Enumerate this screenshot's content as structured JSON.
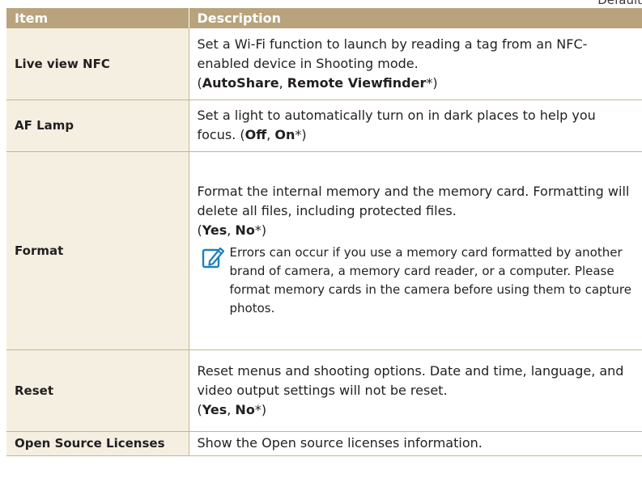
{
  "corner_label": "Default",
  "table": {
    "headers": [
      "Item",
      "Description"
    ],
    "rows": [
      {
        "item": "Live view NFC",
        "description": "Set a Wi-Fi function to launch by reading a tag from an NFC-enabled device in Shooting mode.",
        "options": [
          "AutoShare",
          "Remote Viewfinder"
        ],
        "default_marker": "*"
      },
      {
        "item": "AF Lamp",
        "description": "Set a light to automatically turn on in dark places to help you focus.",
        "options": [
          "Off",
          "On"
        ],
        "default_marker": "*"
      },
      {
        "item": "Format",
        "description": "Format the internal memory and the memory card. Formatting will delete all files, including protected files.",
        "options": [
          "Yes",
          "No"
        ],
        "default_marker": "*",
        "note_icon": "note-pencil-icon",
        "note": "Errors can occur if you use a memory card formatted by another brand of camera, a memory card reader, or a computer. Please format memory cards in the camera before using them to capture photos."
      },
      {
        "item": "Reset",
        "description": "Reset menus and shooting options. Date and time, language, and video output settings will not be reset.",
        "options": [
          "Yes",
          "No"
        ],
        "default_marker": "*"
      },
      {
        "item": "Open Source Licenses",
        "description": "Show the Open source licenses information."
      }
    ]
  },
  "colors": {
    "header_bg": "#b8a37d",
    "item_bg": "#f4efe1",
    "border": "#c7b48f",
    "note_icon": "#1f7fbf"
  }
}
